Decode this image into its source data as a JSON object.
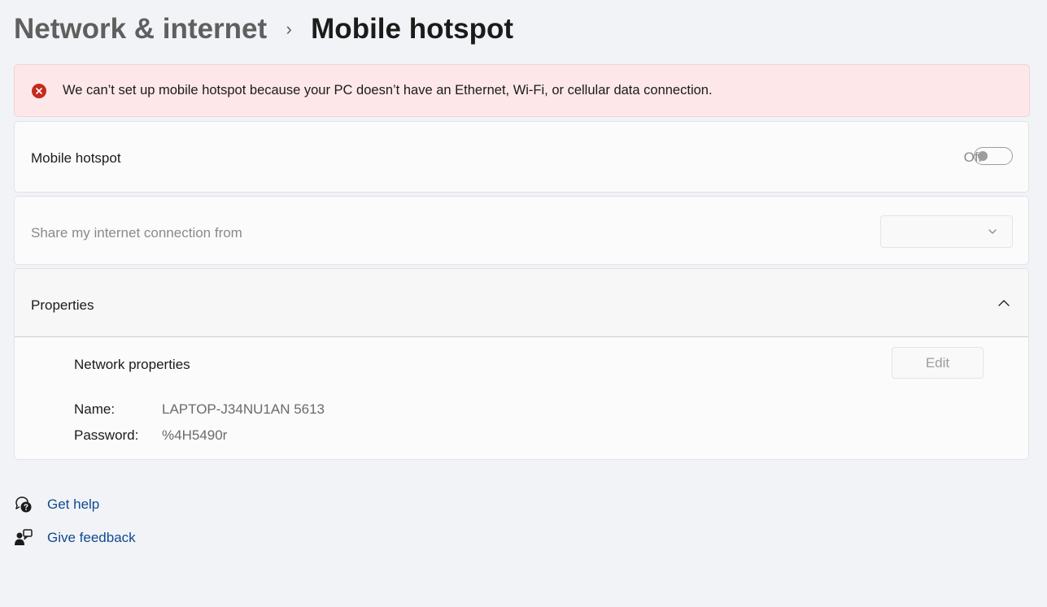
{
  "breadcrumb": {
    "parent": "Network & internet",
    "separator": "›",
    "current": "Mobile hotspot"
  },
  "error": {
    "icon": "error-circle-icon",
    "message": "We can’t set up mobile hotspot because your PC doesn’t have an Ethernet, Wi-Fi, or cellular data connection."
  },
  "hotspot": {
    "label": "Mobile hotspot",
    "state_label": "Off",
    "enabled": false
  },
  "share": {
    "label": "Share my internet connection from",
    "selected_value": ""
  },
  "properties": {
    "title": "Properties",
    "expanded": true,
    "section_label": "Network properties",
    "edit_label": "Edit",
    "name_label": "Name:",
    "name_value": "LAPTOP-J34NU1AN 5613",
    "password_label": "Password:",
    "password_value": "%4H5490r"
  },
  "links": {
    "help": "Get help",
    "feedback": "Give feedback"
  },
  "colors": {
    "accent_link": "#0f4a92",
    "error_bg": "#fde7e9",
    "error_icon": "#c42b1c"
  }
}
